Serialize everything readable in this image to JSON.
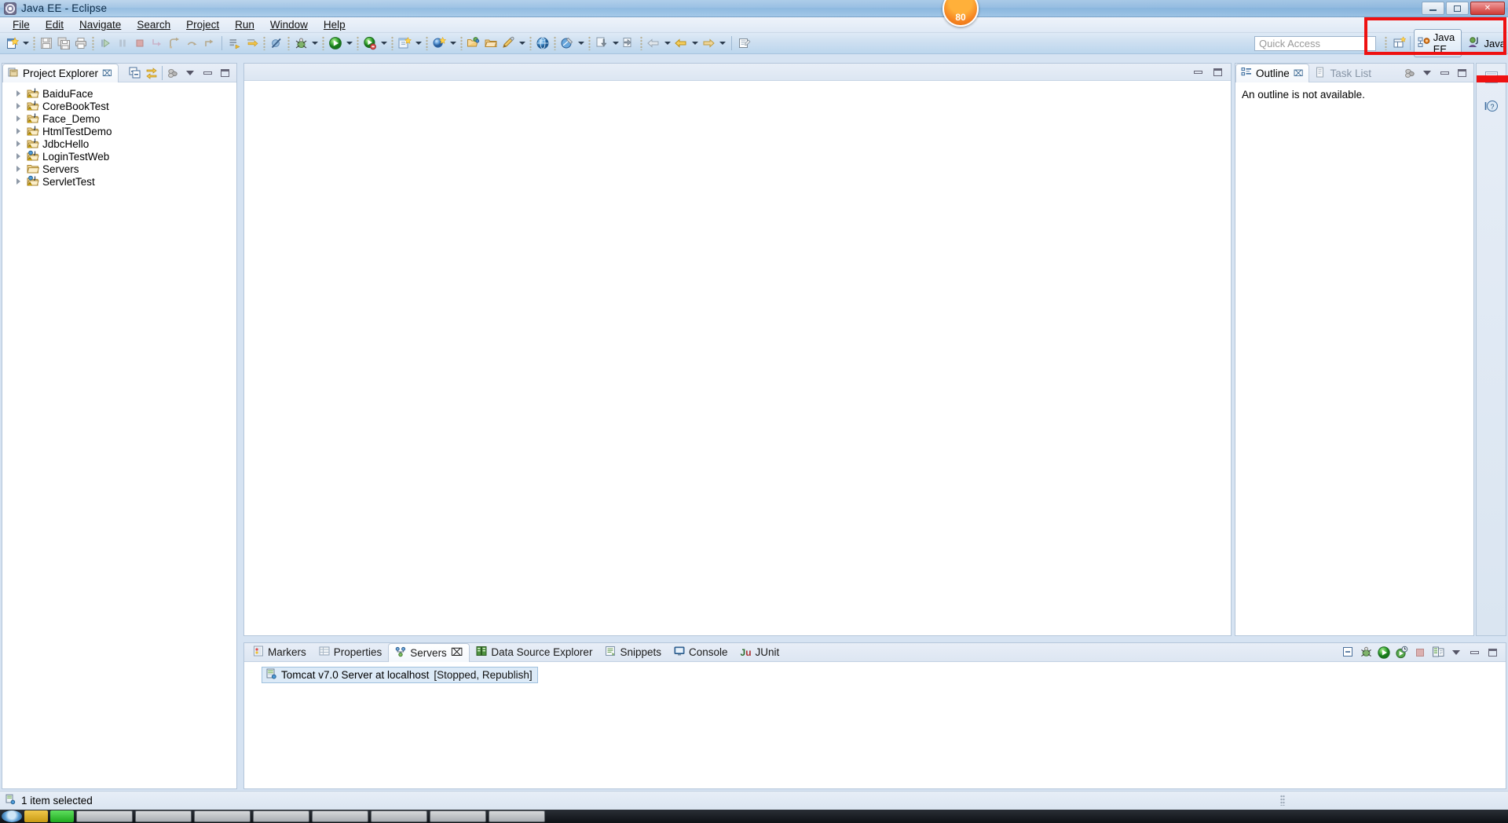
{
  "window": {
    "title": "Java EE - Eclipse",
    "icon": "eclipse-icon",
    "badge_count": "80",
    "buttons": {
      "minimize": "—",
      "restore": "❐",
      "close": "✕"
    }
  },
  "menubar": {
    "items": [
      {
        "label": "File"
      },
      {
        "label": "Edit"
      },
      {
        "label": "Navigate"
      },
      {
        "label": "Search"
      },
      {
        "label": "Project"
      },
      {
        "label": "Run"
      },
      {
        "label": "Window"
      },
      {
        "label": "Help"
      }
    ]
  },
  "toolbar": {
    "icons": [
      "new-wizard-icon",
      "save-icon",
      "save-all-icon",
      "print-icon",
      "resume-icon",
      "suspend-icon",
      "terminate-icon",
      "step-into-icon",
      "step-over-icon",
      "step-return-icon",
      "step-filters-icon",
      "next-annotation-icon",
      "previous-annotation-icon",
      "skip-breakpoints-icon",
      "debug-icon",
      "run-icon",
      "run-as-server-icon",
      "new-java-project-icon",
      "new-class-icon",
      "open-type-icon",
      "open-task-icon",
      "search-icon",
      "pencil-edit-icon",
      "web-browser-icon",
      "external-tools-icon",
      "import-icon",
      "export-icon",
      "back-icon",
      "forward-icon",
      "new-editor-icon"
    ]
  },
  "quick_access": {
    "placeholder": "Quick Access",
    "value": ""
  },
  "perspectives": {
    "open_perspective_label": "Open Perspective",
    "items": [
      {
        "label": "Java EE",
        "icon": "java-ee-perspective-icon",
        "active": true
      },
      {
        "label": "Java",
        "icon": "java-perspective-icon",
        "active": false
      }
    ]
  },
  "project_explorer": {
    "tab_label": "Project Explorer",
    "tab_icon": "project-explorer-icon",
    "close_glyph": "⌧",
    "toolbar": [
      "collapse-all-icon",
      "link-with-editor-icon",
      "view-menu-icon"
    ],
    "tree": [
      {
        "label": "BaiduFace",
        "icon": "java-project-warning-icon",
        "expandable": true
      },
      {
        "label": "CoreBookTest",
        "icon": "java-project-warning-icon",
        "expandable": true
      },
      {
        "label": "Face_Demo",
        "icon": "java-project-warning-icon",
        "expandable": true
      },
      {
        "label": "HtmlTestDemo",
        "icon": "java-project-warning-icon",
        "expandable": true
      },
      {
        "label": "JdbcHello",
        "icon": "java-project-warning-icon",
        "expandable": true
      },
      {
        "label": "LoginTestWeb",
        "icon": "web-project-warning-icon",
        "expandable": true
      },
      {
        "label": "Servers",
        "icon": "folder-icon",
        "expandable": true
      },
      {
        "label": "ServletTest",
        "icon": "web-project-warning-icon",
        "expandable": true
      }
    ]
  },
  "editor_area": {
    "content": "",
    "minimize_title": "Minimize",
    "maximize_title": "Maximize"
  },
  "outline": {
    "tabs": [
      {
        "label": "Outline",
        "icon": "outline-icon",
        "active": true,
        "close_glyph": "⌧"
      },
      {
        "label": "Task List",
        "icon": "task-list-icon",
        "active": false,
        "close_glyph": ""
      }
    ],
    "message": "An outline is not available."
  },
  "fastbar": {
    "items": [
      {
        "icon": "restore-view-icon"
      },
      {
        "icon": "cheat-sheets-icon"
      }
    ]
  },
  "bottom_panel": {
    "tabs": [
      {
        "label": "Markers",
        "icon": "markers-icon",
        "active": false,
        "close_glyph": ""
      },
      {
        "label": "Properties",
        "icon": "properties-icon",
        "active": false,
        "close_glyph": ""
      },
      {
        "label": "Servers",
        "icon": "servers-icon",
        "active": true,
        "close_glyph": "⌧"
      },
      {
        "label": "Data Source Explorer",
        "icon": "datasource-icon",
        "active": false,
        "close_glyph": ""
      },
      {
        "label": "Snippets",
        "icon": "snippets-icon",
        "active": false,
        "close_glyph": ""
      },
      {
        "label": "Console",
        "icon": "console-icon",
        "active": false,
        "close_glyph": ""
      },
      {
        "label": "JUnit",
        "icon": "junit-icon",
        "active": false,
        "close_glyph": ""
      }
    ],
    "toolbar": [
      "collapse-all-icon",
      "debug-server-icon",
      "start-server-icon",
      "profile-server-icon",
      "stop-server-icon",
      "publish-icon",
      "view-menu-icon",
      "minimize-icon",
      "maximize-icon"
    ],
    "servers": [
      {
        "name": "Tomcat v7.0 Server at localhost",
        "state": "[Stopped, Republish]",
        "icon": "tomcat-server-icon",
        "selected": true
      }
    ]
  },
  "statusbar": {
    "icon": "selection-icon",
    "text": "1 item selected"
  },
  "colors": {
    "highlight_box": "#ee1111",
    "accent_blue": "#2b5c8a",
    "panel_bg": "#ffffff",
    "chrome_bg": "#cfe0f1"
  }
}
